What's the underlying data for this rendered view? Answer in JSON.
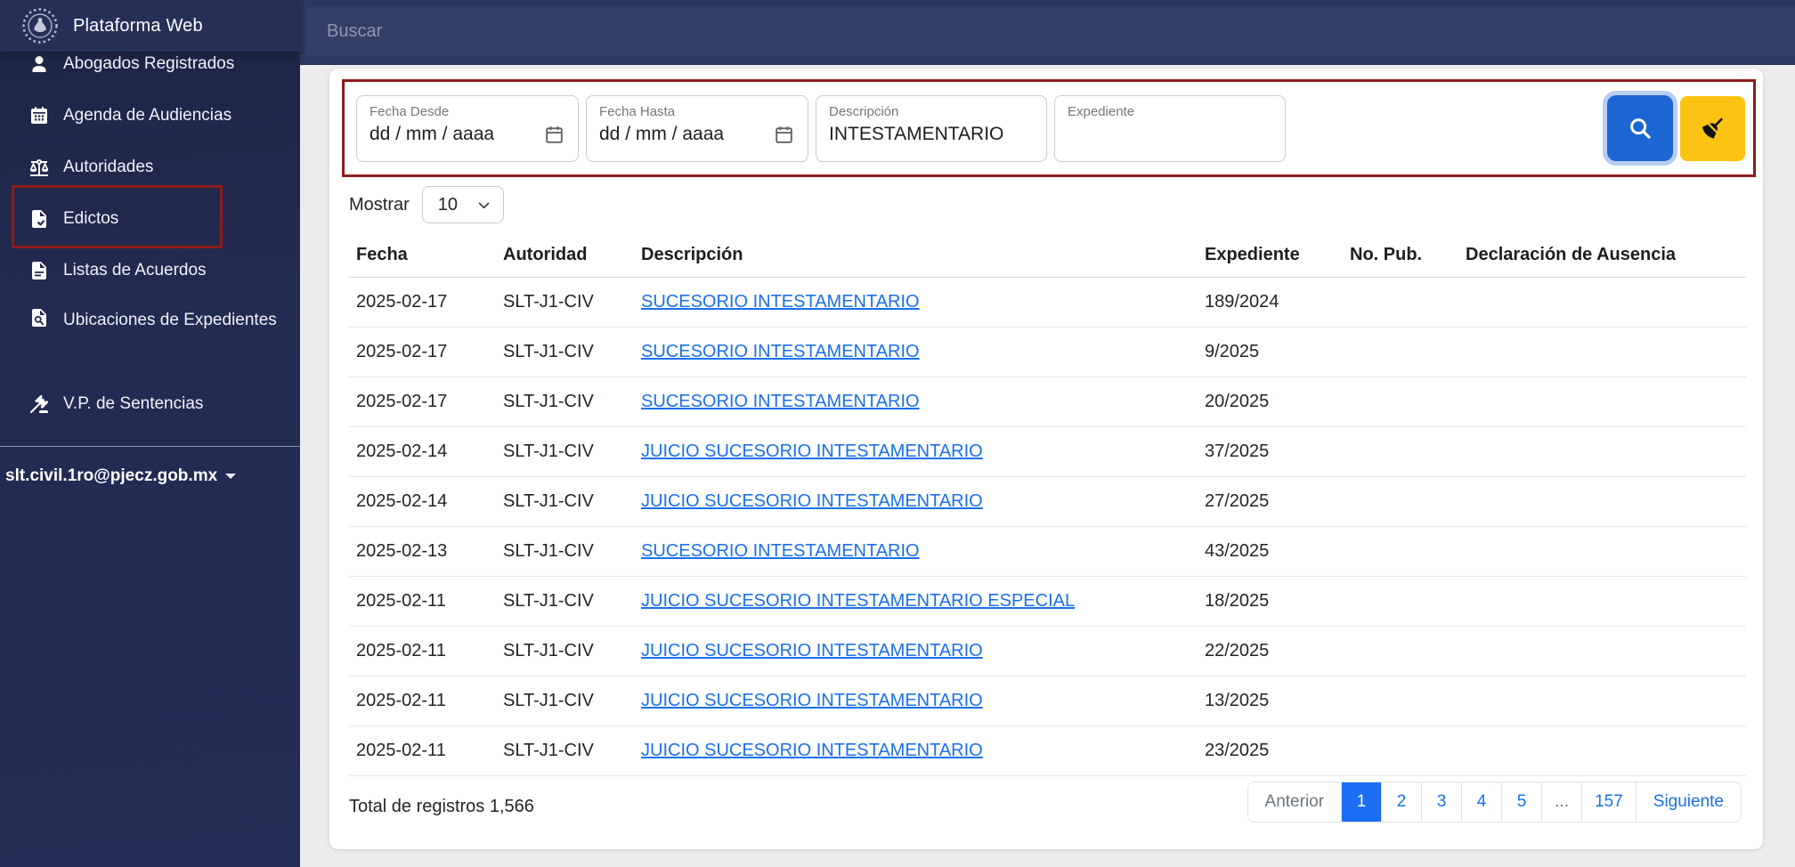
{
  "sidebar": {
    "brand": "Plataforma Web",
    "items": [
      {
        "label": "Abogados Registrados",
        "icon": "user-icon"
      },
      {
        "label": "Agenda de Audiencias",
        "icon": "calendar-icon"
      },
      {
        "label": "Autoridades",
        "icon": "scales-icon"
      },
      {
        "label": "Edictos",
        "icon": "document-check-icon",
        "highlighted": true
      },
      {
        "label": "Listas de Acuerdos",
        "icon": "document-icon"
      },
      {
        "label": "Ubicaciones de Expedientes",
        "icon": "document-search-icon"
      },
      {
        "label": "V.P. de Sentencias",
        "icon": "gavel-icon"
      }
    ],
    "user_email": "slt.civil.1ro@pjecz.gob.mx"
  },
  "topbar": {
    "search_placeholder": "Buscar"
  },
  "filters": {
    "fecha_desde": {
      "label": "Fecha Desde",
      "value": "dd / mm / aaaa"
    },
    "fecha_hasta": {
      "label": "Fecha Hasta",
      "value": "dd / mm / aaaa"
    },
    "descripcion": {
      "label": "Descripción",
      "value": "INTESTAMENTARIO"
    },
    "expediente": {
      "label": "Expediente",
      "value": ""
    }
  },
  "list_controls": {
    "mostrar_label": "Mostrar",
    "page_size": "10"
  },
  "table": {
    "columns": [
      "Fecha",
      "Autoridad",
      "Descripción",
      "Expediente",
      "No. Pub.",
      "Declaración de Ausencia"
    ],
    "rows": [
      {
        "fecha": "2025-02-17",
        "autoridad": "SLT-J1-CIV",
        "descripcion": "SUCESORIO INTESTAMENTARIO",
        "expediente": "189/2024",
        "no_pub": "",
        "declaracion": ""
      },
      {
        "fecha": "2025-02-17",
        "autoridad": "SLT-J1-CIV",
        "descripcion": "SUCESORIO INTESTAMENTARIO",
        "expediente": "9/2025",
        "no_pub": "",
        "declaracion": ""
      },
      {
        "fecha": "2025-02-17",
        "autoridad": "SLT-J1-CIV",
        "descripcion": "SUCESORIO INTESTAMENTARIO",
        "expediente": "20/2025",
        "no_pub": "",
        "declaracion": ""
      },
      {
        "fecha": "2025-02-14",
        "autoridad": "SLT-J1-CIV",
        "descripcion": "JUICIO SUCESORIO INTESTAMENTARIO",
        "expediente": "37/2025",
        "no_pub": "",
        "declaracion": ""
      },
      {
        "fecha": "2025-02-14",
        "autoridad": "SLT-J1-CIV",
        "descripcion": "JUICIO SUCESORIO INTESTAMENTARIO",
        "expediente": "27/2025",
        "no_pub": "",
        "declaracion": ""
      },
      {
        "fecha": "2025-02-13",
        "autoridad": "SLT-J1-CIV",
        "descripcion": "SUCESORIO INTESTAMENTARIO",
        "expediente": "43/2025",
        "no_pub": "",
        "declaracion": ""
      },
      {
        "fecha": "2025-02-11",
        "autoridad": "SLT-J1-CIV",
        "descripcion": "JUICIO SUCESORIO INTESTAMENTARIO ESPECIAL",
        "expediente": "18/2025",
        "no_pub": "",
        "declaracion": ""
      },
      {
        "fecha": "2025-02-11",
        "autoridad": "SLT-J1-CIV",
        "descripcion": "JUICIO SUCESORIO INTESTAMENTARIO",
        "expediente": "22/2025",
        "no_pub": "",
        "declaracion": ""
      },
      {
        "fecha": "2025-02-11",
        "autoridad": "SLT-J1-CIV",
        "descripcion": "JUICIO SUCESORIO INTESTAMENTARIO",
        "expediente": "13/2025",
        "no_pub": "",
        "declaracion": ""
      },
      {
        "fecha": "2025-02-11",
        "autoridad": "SLT-J1-CIV",
        "descripcion": "JUICIO SUCESORIO INTESTAMENTARIO",
        "expediente": "23/2025",
        "no_pub": "",
        "declaracion": ""
      }
    ]
  },
  "footer": {
    "total_text": "Total de registros 1,566"
  },
  "pagination": {
    "prev": "Anterior",
    "pages": [
      "1",
      "2",
      "3",
      "4",
      "5",
      "...",
      "157"
    ],
    "active": "1",
    "next": "Siguiente"
  },
  "colors": {
    "sidebar_navy": "#222b50",
    "topbar_navy": "#2d3860",
    "annotation_red": "#8e1c1c",
    "accent_blue": "#1b66d3",
    "accent_yellow": "#fcc312",
    "link_blue": "#1a70ec",
    "active_page_blue": "#1b6ef3"
  }
}
